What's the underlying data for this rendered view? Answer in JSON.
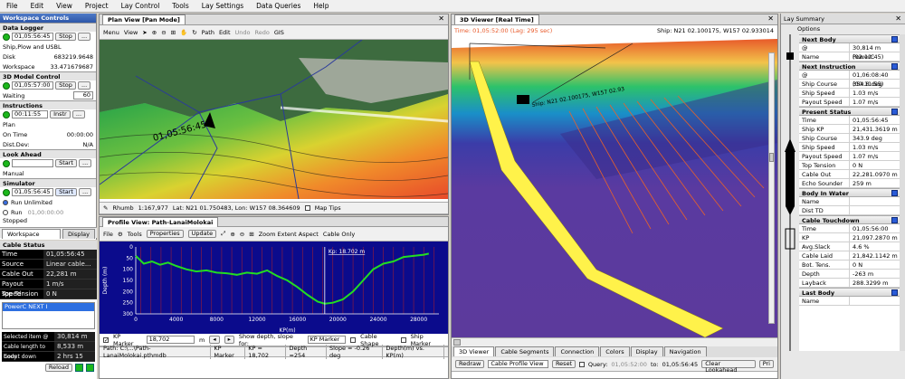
{
  "menu": [
    "File",
    "Edit",
    "View",
    "Project",
    "Lay Control",
    "Tools",
    "Lay Settings",
    "Data Queries",
    "Help"
  ],
  "workspace": {
    "title": "Workspace Controls",
    "data_logger": {
      "title": "Data Logger",
      "time": "01,05:56:45",
      "stop": "Stop",
      "ellipsis": "...",
      "ship_label": "Ship,Plow and USBL",
      "disk_label": "Disk",
      "disk_value": "683219.9648",
      "workspace_label": "Workspace",
      "workspace_value": "33.471679687"
    },
    "model": {
      "title": "3D Model Control",
      "time": "01,05:57:00",
      "stop": "Stop",
      "ellipsis": "...",
      "waiting_label": "Waiting",
      "waiting_value": "60"
    },
    "instructions": {
      "title": "Instructions",
      "time": "00:11:55",
      "instr": "Instr",
      "ellipsis": "...",
      "plan": "Plan",
      "on_time_label": "On Time",
      "on_time_value": "00:00:00",
      "dist_label": "Dist.Dev:",
      "dist_value": "N/A"
    },
    "look_ahead": {
      "title": "Look Ahead",
      "start": "Start",
      "ellipsis": "...",
      "manual": "Manual"
    },
    "simulator": {
      "title": "Simulator",
      "time": "01,05:56:45",
      "start": "Start",
      "ellipsis": "...",
      "run_unlimited": "Run Unlimited",
      "run": "Run",
      "run_time": "01,00:00:00",
      "stopped": "Stopped"
    },
    "tab_workspace": "Workspace Controls",
    "tab_display": "Display"
  },
  "cable_status": {
    "title": "Cable Status",
    "rows": [
      {
        "k": "Time",
        "v": "01,05:56:45"
      },
      {
        "k": "Source",
        "v": "Linear cable..."
      },
      {
        "k": "Cable Out",
        "v": "22,281 m"
      },
      {
        "k": "Payout speed",
        "v": "1 m/s"
      },
      {
        "k": "Top Tension",
        "v": "0 N"
      }
    ],
    "list_item": "PowerC NEXT I",
    "sel_rows": [
      {
        "k": "Selected item @",
        "v": "30,814 m"
      },
      {
        "k": "Cable length to body",
        "v": "8,533 m"
      },
      {
        "k": "Count down",
        "v": "2 hrs 15 mins"
      }
    ],
    "reload": "Reload"
  },
  "plan_view": {
    "tab": "Plan View [Pan Mode]",
    "menu": "Menu",
    "view": "View",
    "path": "Path",
    "edit": "Edit",
    "undo": "Undo",
    "redo": "Redo",
    "gis": "GIS",
    "kp_label": "01,05:56:45",
    "rhumb": "Rhumb",
    "scale": "1:167,977",
    "latlon": "Lat: N21 01.750483, Lon: W157 08.364609",
    "map_tips": "Map Tips"
  },
  "profile": {
    "tab": "Profile View: Path-LanaiMolokai",
    "file": "File",
    "tools": "Tools",
    "properties": "Properties",
    "update": "Update",
    "zoom_extent": "Zoom Extent Aspect",
    "cable_only": "Cable Only",
    "kp_marker_readout": "Kp: 18.702 m",
    "ylabel": "Depth (m)",
    "xlabel": "KP(m)",
    "kp_check": "KP Marker",
    "kp_value": "18,702",
    "kp_unit": "m",
    "show_depth": "Show depth, slope for:",
    "kp_select": "KP Marker",
    "cable_shape": "Cable Shape",
    "ship_marker": "Ship Marker",
    "status": [
      "Path: C:\\...\\Path-LanaiMolokai.pthmdb",
      "KP Marker",
      "KP = 18,702",
      "Depth =254",
      "Slope = -0.26 deg",
      "Depth(m) vs. KP(m)"
    ]
  },
  "chart_data": {
    "type": "line",
    "xlabel": "KP(m)",
    "ylabel": "Depth (m)",
    "xlim": [
      0,
      30000
    ],
    "ylim": [
      300,
      0
    ],
    "xticks": [
      0,
      4000,
      8000,
      12000,
      16000,
      20000,
      24000,
      28000
    ],
    "yticks": [
      0,
      50,
      100,
      150,
      200,
      250,
      300
    ],
    "marker_kp": 18702,
    "x": [
      0,
      800,
      1600,
      2400,
      3200,
      4000,
      5000,
      6000,
      7000,
      8000,
      9000,
      10000,
      11000,
      12000,
      13000,
      14000,
      15000,
      16000,
      17000,
      18000,
      18700,
      19500,
      20500,
      21500,
      22500,
      23500,
      24500,
      25500,
      26500,
      27500,
      28500,
      29000
    ],
    "y": [
      40,
      75,
      65,
      80,
      70,
      85,
      100,
      110,
      105,
      115,
      118,
      125,
      115,
      120,
      105,
      130,
      150,
      180,
      215,
      245,
      254,
      250,
      235,
      200,
      150,
      100,
      75,
      65,
      45,
      40,
      35,
      30
    ]
  },
  "viewer": {
    "tab": "3D Viewer [Real Time]",
    "time_overlay": "Time: 01,05:52:00 (Lag: 295 sec)",
    "ship_overlay": "Ship: N21 02.100175, W157 02.933014",
    "ship_label": "Ship: N21 02.100175, W157 02.93",
    "tabs": [
      "3D Viewer",
      "Cable Segments",
      "Connection",
      "Colors",
      "Display",
      "Navigation"
    ],
    "redraw": "Redraw",
    "mode": "Cable Profile View",
    "reset": "Reset",
    "query": "Query:",
    "query_time": "01,05:52:00",
    "to": "to:",
    "to_time": "01,05:56:45",
    "clear": "Clear Lookahead",
    "pri": "Pri"
  },
  "lay_summary": {
    "title": "Lay Summary",
    "options": "Options",
    "next_body": {
      "title": "Next Body",
      "rows": [
        {
          "k": "@",
          "v": "30,814 m (02:12:45)"
        },
        {
          "k": "Name",
          "v": "PowerC"
        }
      ]
    },
    "next_instruction": {
      "title": "Next Instruction",
      "rows": [
        {
          "k": "@",
          "v": "01,06:08:40 (00:11:55)"
        },
        {
          "k": "Ship Course",
          "v": "354.8  deg"
        },
        {
          "k": "Ship Speed",
          "v": "1.03 m/s"
        },
        {
          "k": "Payout Speed",
          "v": "1.07 m/s"
        }
      ]
    },
    "present_status": {
      "title": "Present Status",
      "rows": [
        {
          "k": "Time",
          "v": "01,05:56:45"
        },
        {
          "k": "Ship KP",
          "v": "21,431.3619 m"
        },
        {
          "k": "Ship Course",
          "v": "343.9  deg"
        },
        {
          "k": "Ship Speed",
          "v": "1.03 m/s"
        },
        {
          "k": "Payout Speed",
          "v": "1.07 m/s"
        },
        {
          "k": "Top Tension",
          "v": "0 N"
        },
        {
          "k": "Cable Out",
          "v": "22,281.0970 m"
        },
        {
          "k": "Echo Sounder",
          "v": "259 m"
        }
      ]
    },
    "body_in_water": {
      "title": "Body In Water",
      "rows": [
        {
          "k": "Name",
          "v": ""
        },
        {
          "k": "Dist TD",
          "v": ""
        }
      ]
    },
    "cable_touchdown": {
      "title": "Cable Touchdown",
      "rows": [
        {
          "k": "Time",
          "v": "01,05:56:00"
        },
        {
          "k": "KP",
          "v": "21,097.2870 m"
        },
        {
          "k": "Avg.Slack",
          "v": "4.6 %"
        },
        {
          "k": "Cable Laid",
          "v": "21,842.1142 m"
        },
        {
          "k": "Bot. Tens.",
          "v": "0 N"
        },
        {
          "k": "Depth",
          "v": "-263 m"
        },
        {
          "k": "Layback",
          "v": "288.3299 m"
        }
      ]
    },
    "last_body": {
      "title": "Last Body",
      "rows": [
        {
          "k": "Name",
          "v": ""
        }
      ]
    }
  },
  "colors": {
    "accent": "#2d56a8",
    "ocean": "#0b0b8c",
    "profile_line": "#22dd22",
    "kp_line": "#ffffff",
    "cable": "#fff24a"
  }
}
